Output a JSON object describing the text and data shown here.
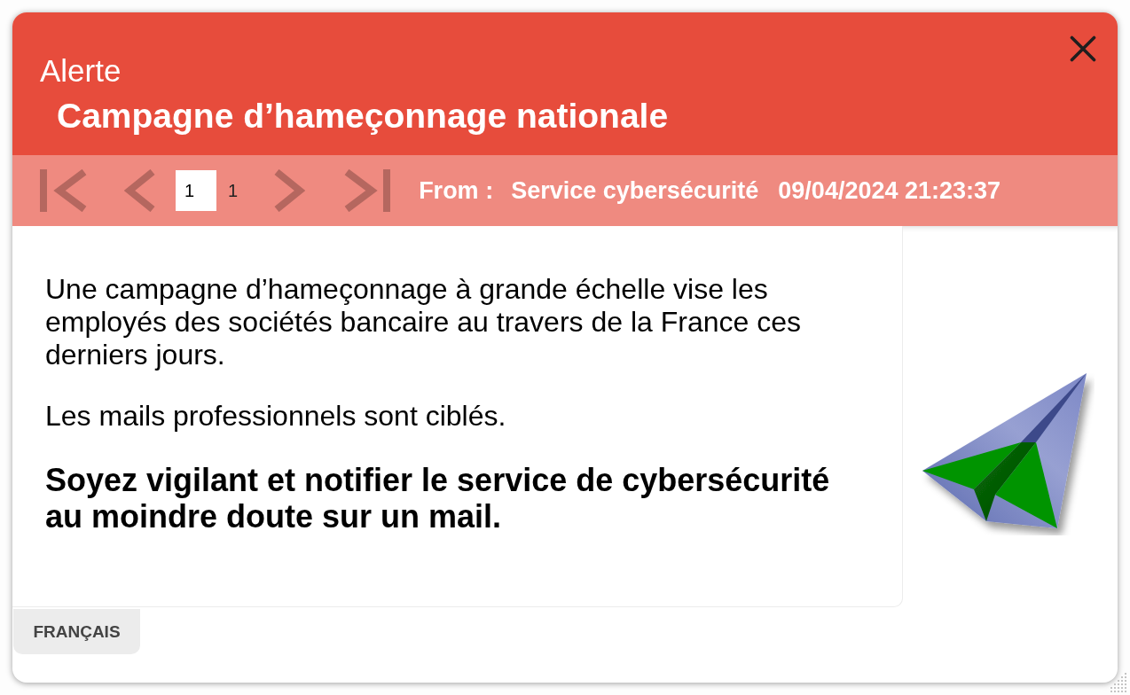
{
  "header": {
    "label": "Alerte",
    "title": "Campagne d’hameçonnage nationale"
  },
  "toolbar": {
    "back_buttons": [
      {
        "kind": "first",
        "disabled": true
      },
      {
        "kind": "previous",
        "disabled": true
      }
    ],
    "page": "1",
    "page_count": "1",
    "forward_buttons": [
      {
        "kind": "next",
        "disabled": true
      },
      {
        "kind": "last",
        "disabled": true
      }
    ],
    "from_label": "From :",
    "sender": "Service cybersécurité",
    "timestamp": "09/04/2024 21:23:37"
  },
  "message": {
    "paragraphs": [
      {
        "kind": "body",
        "text": "Une campagne d’hameçonnage à grande échelle vise les employés des sociétés bancaire au travers de la France ces derniers jours."
      },
      {
        "kind": "body",
        "text": "Les mails professionnels sont ciblés."
      },
      {
        "kind": "emphasis",
        "text": "Soyez vigilant et notifier le service de cybersécurité au moindre doute sur un mail."
      }
    ]
  },
  "language_tabs": [
    {
      "label": "FRANÇAIS",
      "selected": true
    }
  ]
}
